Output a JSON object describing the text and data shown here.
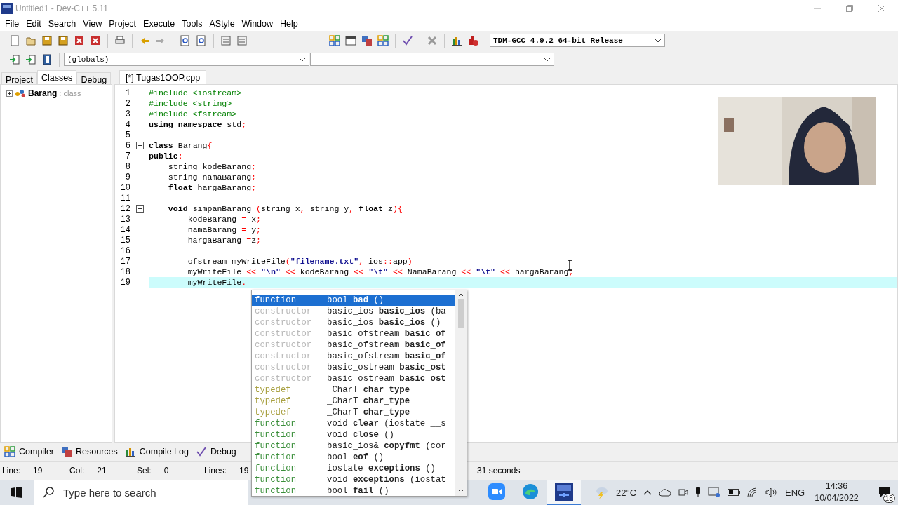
{
  "window": {
    "title": "Untitled1 - Dev-C++ 5.11"
  },
  "menu": [
    "File",
    "Edit",
    "Search",
    "View",
    "Project",
    "Execute",
    "Tools",
    "AStyle",
    "Window",
    "Help"
  ],
  "compiler_select": {
    "value": "TDM-GCC 4.9.2 64-bit Release"
  },
  "scope_select": {
    "value": "(globals)"
  },
  "side_tabs": [
    {
      "label": "Project",
      "selected": false
    },
    {
      "label": "Classes",
      "selected": true
    },
    {
      "label": "Debug",
      "selected": false
    }
  ],
  "class_tree": [
    {
      "name": "Barang",
      "type": ": class",
      "expanded": false
    }
  ],
  "editor_tabs": [
    {
      "label": "[*] Tugas1OOP.cpp",
      "selected": true
    }
  ],
  "code": [
    {
      "number": "1",
      "foldable": false,
      "current": false,
      "tokens": [
        {
          "t": "#include <iostream>",
          "kind": "pre"
        }
      ]
    },
    {
      "number": "2",
      "foldable": false,
      "current": false,
      "tokens": [
        {
          "t": "#include <string>",
          "kind": "pre"
        }
      ]
    },
    {
      "number": "3",
      "foldable": false,
      "current": false,
      "tokens": [
        {
          "t": "#include <fstream>",
          "kind": "pre"
        }
      ]
    },
    {
      "number": "4",
      "foldable": false,
      "current": false,
      "tokens": [
        {
          "t": "using namespace",
          "kind": "kw"
        },
        {
          "t": " std",
          "kind": "p"
        },
        {
          "t": ";",
          "kind": "op"
        }
      ]
    },
    {
      "number": "5",
      "foldable": false,
      "current": false
    },
    {
      "number": "6",
      "foldable": true,
      "current": false,
      "tokens": [
        {
          "t": "class",
          "kind": "kw"
        },
        {
          "t": " Barang",
          "kind": "p"
        },
        {
          "t": "{",
          "kind": "op"
        }
      ]
    },
    {
      "number": "7",
      "foldable": false,
      "current": false,
      "tokens": [
        {
          "t": "public",
          "kind": "kw"
        },
        {
          "t": ":",
          "kind": "op"
        }
      ]
    },
    {
      "number": "8",
      "foldable": false,
      "current": false,
      "tokens": [
        {
          "t": "    string kodeBarang",
          "kind": "p"
        },
        {
          "t": ";",
          "kind": "op"
        }
      ]
    },
    {
      "number": "9",
      "foldable": false,
      "current": false,
      "tokens": [
        {
          "t": "    string namaBarang",
          "kind": "p"
        },
        {
          "t": ";",
          "kind": "op"
        }
      ]
    },
    {
      "number": "10",
      "foldable": false,
      "current": false,
      "tokens": [
        {
          "t": "    float",
          "kind": "kw"
        },
        {
          "t": " hargaBarang",
          "kind": "p"
        },
        {
          "t": ";",
          "kind": "op"
        }
      ]
    },
    {
      "number": "11",
      "foldable": false,
      "current": false
    },
    {
      "number": "12",
      "foldable": true,
      "current": false,
      "tokens": [
        {
          "t": "    void",
          "kind": "kw"
        },
        {
          "t": " simpanBarang ",
          "kind": "p"
        },
        {
          "t": "(",
          "kind": "op"
        },
        {
          "t": "string x",
          "kind": "p"
        },
        {
          "t": ",",
          "kind": "op"
        },
        {
          "t": " string y",
          "kind": "p"
        },
        {
          "t": ",",
          "kind": "op"
        },
        {
          "t": " float",
          "kind": "kw"
        },
        {
          "t": " z",
          "kind": "p"
        },
        {
          "t": "){",
          "kind": "op"
        }
      ]
    },
    {
      "number": "13",
      "foldable": false,
      "current": false,
      "tokens": [
        {
          "t": "        kodeBarang ",
          "kind": "p"
        },
        {
          "t": "=",
          "kind": "op"
        },
        {
          "t": " x",
          "kind": "p"
        },
        {
          "t": ";",
          "kind": "op"
        }
      ]
    },
    {
      "number": "14",
      "foldable": false,
      "current": false,
      "tokens": [
        {
          "t": "        namaBarang ",
          "kind": "p"
        },
        {
          "t": "=",
          "kind": "op"
        },
        {
          "t": " y",
          "kind": "p"
        },
        {
          "t": ";",
          "kind": "op"
        }
      ]
    },
    {
      "number": "15",
      "foldable": false,
      "current": false,
      "tokens": [
        {
          "t": "        hargaBarang ",
          "kind": "p"
        },
        {
          "t": "=",
          "kind": "op"
        },
        {
          "t": "z",
          "kind": "p"
        },
        {
          "t": ";",
          "kind": "op"
        }
      ]
    },
    {
      "number": "16",
      "foldable": false,
      "current": false
    },
    {
      "number": "17",
      "foldable": false,
      "current": false,
      "tokens": [
        {
          "t": "        ofstream myWriteFile",
          "kind": "p"
        },
        {
          "t": "(",
          "kind": "op"
        },
        {
          "t": "\"filename.txt\"",
          "kind": "str"
        },
        {
          "t": ",",
          "kind": "op"
        },
        {
          "t": " ios",
          "kind": "p"
        },
        {
          "t": "::",
          "kind": "op"
        },
        {
          "t": "app",
          "kind": "p"
        },
        {
          "t": ")",
          "kind": "op"
        }
      ]
    },
    {
      "number": "18",
      "foldable": false,
      "current": false,
      "tokens": [
        {
          "t": "        myWriteFile ",
          "kind": "p"
        },
        {
          "t": "<<",
          "kind": "op"
        },
        {
          "t": " \"\\n\" ",
          "kind": "str"
        },
        {
          "t": "<<",
          "kind": "op"
        },
        {
          "t": " kodeBarang ",
          "kind": "p"
        },
        {
          "t": "<<",
          "kind": "op"
        },
        {
          "t": " \"\\t\" ",
          "kind": "str"
        },
        {
          "t": "<<",
          "kind": "op"
        },
        {
          "t": " NamaBarang ",
          "kind": "p"
        },
        {
          "t": "<<",
          "kind": "op"
        },
        {
          "t": " \"\\t\" ",
          "kind": "str"
        },
        {
          "t": "<<",
          "kind": "op"
        },
        {
          "t": " hargaBarang",
          "kind": "p"
        },
        {
          "t": ";",
          "kind": "op"
        }
      ]
    },
    {
      "number": "19",
      "foldable": false,
      "current": true,
      "tokens": [
        {
          "t": "        myWriteFile",
          "kind": "p"
        },
        {
          "t": ".",
          "kind": "op"
        }
      ]
    }
  ],
  "completion": [
    {
      "kind": "function",
      "label": "function",
      "signature": "bool **bad** ()",
      "selected": true
    },
    {
      "kind": "constructor",
      "label": "constructor",
      "signature": "basic_ios **basic_ios** (ba",
      "selected": false
    },
    {
      "kind": "constructor",
      "label": "constructor",
      "signature": "basic_ios **basic_ios** ()",
      "selected": false
    },
    {
      "kind": "constructor",
      "label": "constructor",
      "signature": "basic_ofstream **basic_of**",
      "selected": false
    },
    {
      "kind": "constructor",
      "label": "constructor",
      "signature": "basic_ofstream **basic_of**",
      "selected": false
    },
    {
      "kind": "constructor",
      "label": "constructor",
      "signature": "basic_ofstream **basic_of**",
      "selected": false
    },
    {
      "kind": "constructor",
      "label": "constructor",
      "signature": "basic_ostream **basic_ost**",
      "selected": false
    },
    {
      "kind": "constructor",
      "label": "constructor",
      "signature": "basic_ostream **basic_ost**",
      "selected": false
    },
    {
      "kind": "typedef",
      "label": "typedef",
      "signature": "_CharT **char_type**",
      "selected": false
    },
    {
      "kind": "typedef",
      "label": "typedef",
      "signature": "_CharT **char_type**",
      "selected": false
    },
    {
      "kind": "typedef",
      "label": "typedef",
      "signature": "_CharT **char_type**",
      "selected": false
    },
    {
      "kind": "function",
      "label": "function",
      "signature": "void **clear** (iostate __s",
      "selected": false
    },
    {
      "kind": "function",
      "label": "function",
      "signature": "void **close** ()",
      "selected": false
    },
    {
      "kind": "function",
      "label": "function",
      "signature": "basic_ios& **copyfmt** (cor",
      "selected": false
    },
    {
      "kind": "function",
      "label": "function",
      "signature": "bool **eof** ()",
      "selected": false
    },
    {
      "kind": "function",
      "label": "function",
      "signature": "iostate **exceptions** ()",
      "selected": false
    },
    {
      "kind": "function",
      "label": "function",
      "signature": "void **exceptions** (iostat",
      "selected": false
    },
    {
      "kind": "function",
      "label": "function",
      "signature": "bool **fail** ()",
      "selected": false
    }
  ],
  "bottom_tabs": [
    "Compiler",
    "Resources",
    "Compile Log",
    "Debug"
  ],
  "status_bar": {
    "fields": [
      {
        "label": "Line:",
        "value": "19"
      },
      {
        "label": "Col:",
        "value": "21"
      },
      {
        "label": "Sel:",
        "value": "0"
      },
      {
        "label": "Lines:",
        "value": "19"
      }
    ],
    "message": "31 seconds"
  },
  "taskbar": {
    "search_placeholder": "Type here to search",
    "apps": [
      {
        "kind": "video",
        "active": false
      },
      {
        "kind": "browser",
        "active": false
      },
      {
        "kind": "devcpp",
        "active": true
      }
    ],
    "weather": "22°C",
    "language": "ENG",
    "time": "14:36",
    "date": "10/04/2022",
    "notifications": "18"
  }
}
